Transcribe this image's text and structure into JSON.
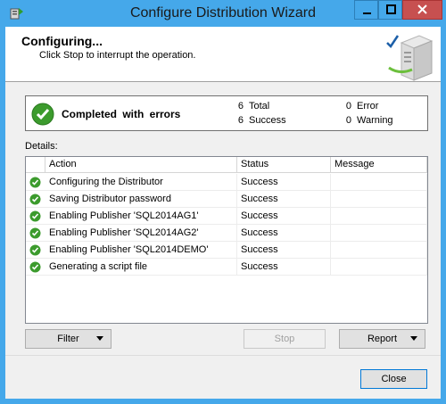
{
  "window": {
    "title": "Configure Distribution Wizard"
  },
  "header": {
    "title": "Configuring...",
    "subtitle": "Click Stop to interrupt the operation."
  },
  "summary": {
    "status": "Completed with errors",
    "total_count": "6",
    "total_label": "Total",
    "success_count": "6",
    "success_label": "Success",
    "error_count": "0",
    "error_label": "Error",
    "warning_count": "0",
    "warning_label": "Warning"
  },
  "details": {
    "label": "Details:",
    "columns": [
      "Action",
      "Status",
      "Message"
    ],
    "rows": [
      {
        "action": "Configuring the Distributor",
        "status": "Success",
        "message": ""
      },
      {
        "action": "Saving Distributor password",
        "status": "Success",
        "message": ""
      },
      {
        "action": "Enabling Publisher 'SQL2014AG1'",
        "status": "Success",
        "message": ""
      },
      {
        "action": "Enabling Publisher 'SQL2014AG2'",
        "status": "Success",
        "message": ""
      },
      {
        "action": "Enabling Publisher 'SQL2014DEMO'",
        "status": "Success",
        "message": ""
      },
      {
        "action": "Generating a script file",
        "status": "Success",
        "message": ""
      }
    ]
  },
  "buttons": {
    "filter": "Filter",
    "stop": "Stop",
    "report": "Report",
    "close": "Close"
  },
  "icons": {
    "app": "wizard-app-icon",
    "success": "green-check-icon",
    "header": "server-check-icon"
  },
  "colors": {
    "titlebar": "#45a8ea",
    "success_green": "#3c9b2d",
    "close_red": "#c75050"
  }
}
